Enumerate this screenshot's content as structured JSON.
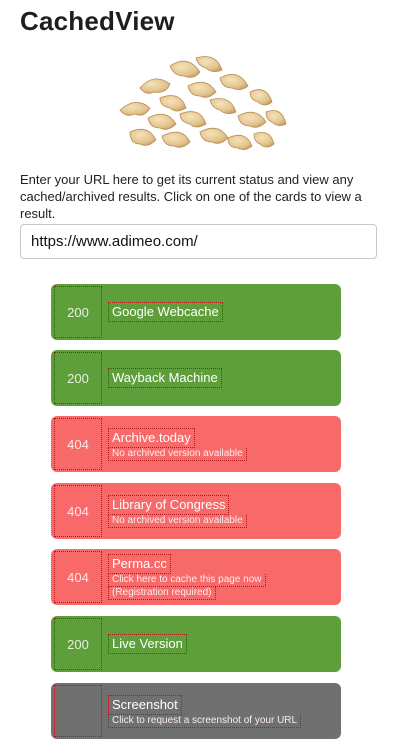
{
  "app": {
    "title": "CachedView"
  },
  "hero": {
    "icon": "cashew-nuts-image"
  },
  "intro": "Enter your URL here to get its current status and view any cached/archived results. Click on one of the cards to view a result.",
  "search": {
    "value": "https://www.adimeo.com/"
  },
  "colors": {
    "success": "#5e9e3b",
    "error": "#f86a6a",
    "neutral": "#707070"
  },
  "cards": [
    {
      "status": "200",
      "name": "Google Webcache",
      "sub": ""
    },
    {
      "status": "200",
      "name": "Wayback Machine",
      "sub": ""
    },
    {
      "status": "404",
      "name": "Archive.today",
      "sub": "No archived version available"
    },
    {
      "status": "404",
      "name": "Library of Congress",
      "sub": "No archived version available"
    },
    {
      "status": "404",
      "name": "Perma.cc",
      "sub": "Click here to cache this page now",
      "sub2": "(Registration required)"
    },
    {
      "status": "200",
      "name": "Live Version",
      "sub": ""
    },
    {
      "status": "",
      "name": "Screenshot",
      "sub": "Click to request a screenshot of your URL"
    }
  ]
}
